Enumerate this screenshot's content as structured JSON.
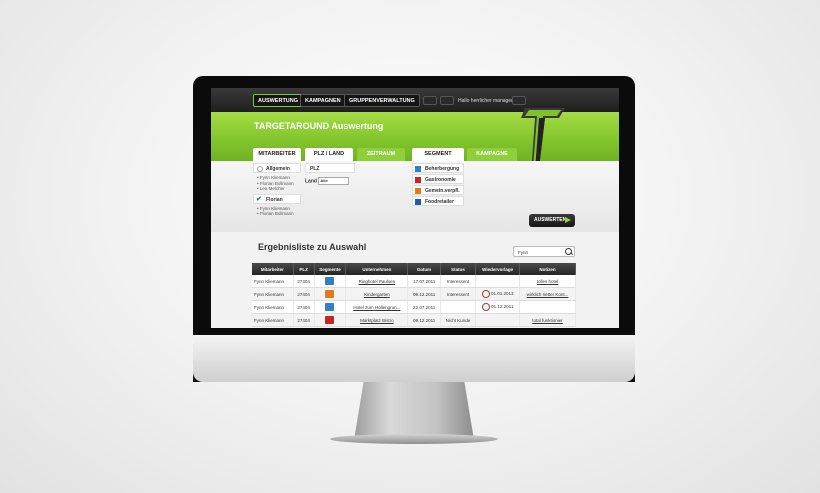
{
  "nav": {
    "items": [
      {
        "label": "AUSWERTUNG",
        "active": true
      },
      {
        "label": "KAMPAGNEN",
        "active": false
      },
      {
        "label": "GRUPPENVERWALTUNG",
        "active": false
      }
    ],
    "greeting": "Hallo herrlicher manager"
  },
  "header": {
    "title": "TARGETAROUND Auswertung"
  },
  "tabs": [
    {
      "label": "MITARBEITER",
      "active": true
    },
    {
      "label": "PLZ / LAND",
      "active": true
    },
    {
      "label": "ZEITRAUM",
      "active": false
    },
    {
      "label": "SEGMENT",
      "active": true
    },
    {
      "label": "KAMPAGNE",
      "active": false
    }
  ],
  "mitarbeiter": {
    "group1": {
      "label": "Allgemein",
      "members": [
        "Fynn Kliemann",
        "Florian Bollmann",
        "Lea Melcher"
      ]
    },
    "group2": {
      "label": "Florian",
      "members": [
        "Fynn Kliemann",
        "Florian Bollmann"
      ]
    }
  },
  "plz": {
    "label": "PLZ",
    "land_label": "Land",
    "land_value": "Alle"
  },
  "segments": [
    {
      "label": "Beherbergung",
      "color": "#2f7fc9"
    },
    {
      "label": "Gastronomie",
      "color": "#c4271f"
    },
    {
      "label": "Gemein.verpfl.",
      "color": "#e07a1b"
    },
    {
      "label": "Foodretailer",
      "color": "#1f5fa0"
    }
  ],
  "auswerten_label": "AUSWERTEN",
  "results": {
    "title": "Ergebnisliste zu Auswahl",
    "search_value": "Fynn",
    "columns": [
      "Mitarbeiter",
      "PLZ",
      "Segmente",
      "Unternehmen",
      "Datum",
      "Status",
      "Wiedervorlage",
      "Notizen"
    ],
    "rows": [
      {
        "mitarbeiter": "Fynn Kliemann",
        "plz": "27404",
        "segment_color": "#2f7fc9",
        "unternehmen": "Ringhotel Paulsen",
        "datum": "17.07.2011",
        "status": "Interessent",
        "wiedervorlage": "",
        "notizen": "tolles hotel"
      },
      {
        "mitarbeiter": "Fynn Kliemann",
        "plz": "27404",
        "segment_color": "#e07a1b",
        "unternehmen": "Kindergarten",
        "datum": "09.12.2011",
        "status": "Interessent",
        "wiedervorlage": "01.01.2013",
        "notizen": "wirklich netter Kont..."
      },
      {
        "mitarbeiter": "Fynn Kliemann",
        "plz": "27404",
        "segment_color": "#2f7fc9",
        "unternehmen": "Hotel zum Hollengrun...",
        "datum": "22.07.2011",
        "status": "",
        "wiedervorlage": "01.12.2011",
        "notizen": ""
      },
      {
        "mitarbeiter": "Fynn Kliemann",
        "plz": "27404",
        "segment_color": "#c4271f",
        "unternehmen": "Marktplatz Bistro",
        "datum": "09.12.2011",
        "status": "Nicht Kunde",
        "wiedervorlage": "",
        "notizen": "total funktionier"
      }
    ]
  }
}
